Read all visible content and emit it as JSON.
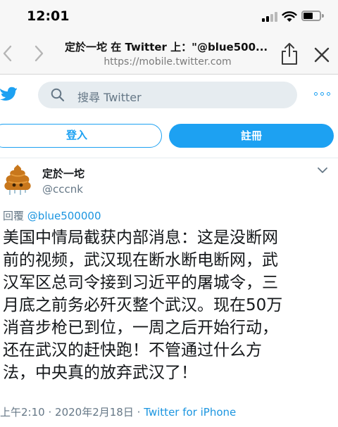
{
  "status_bar": {
    "time": "12:01"
  },
  "browser": {
    "title": "定於一坨 在 Twitter 上：\"@blue500...",
    "url": "https://mobile.twitter.com"
  },
  "header": {
    "search_placeholder": "搜尋 Twitter",
    "login_label": "登入",
    "signup_label": "註冊"
  },
  "tweet": {
    "display_name": "定於一坨",
    "username": "@cccnk",
    "reply_prefix": "回覆",
    "reply_to": "@blue500000",
    "text_lines": [
      "美国中情局截获内部消息：这是没断网",
      "前的视频，武汉现在断水断电断网，武",
      "汉军区总司令接到习近平的屠城令，三",
      "月底之前务必歼灭整个武汉。现在50万",
      "消音步枪已到位，一周之后开始行动，",
      "还在武汉的赶快跑！不管通过什么方",
      "法，中央真的放弃武汉了！"
    ],
    "time": "上午2:10",
    "date": "2020年2月18日",
    "separator": "·",
    "source": "Twitter for iPhone"
  },
  "colors": {
    "accent": "#1da1f2",
    "link": "#1b95e0",
    "secondary_text": "#657786",
    "search_bg": "#e6ecf0"
  },
  "icons": [
    "signal-icon",
    "wifi-icon",
    "battery-icon",
    "back-arrow-icon",
    "forward-arrow-icon",
    "share-icon",
    "close-icon",
    "twitter-bird-icon",
    "search-icon",
    "more-options-icon",
    "avatar-poop-icon",
    "chevron-down-icon"
  ]
}
